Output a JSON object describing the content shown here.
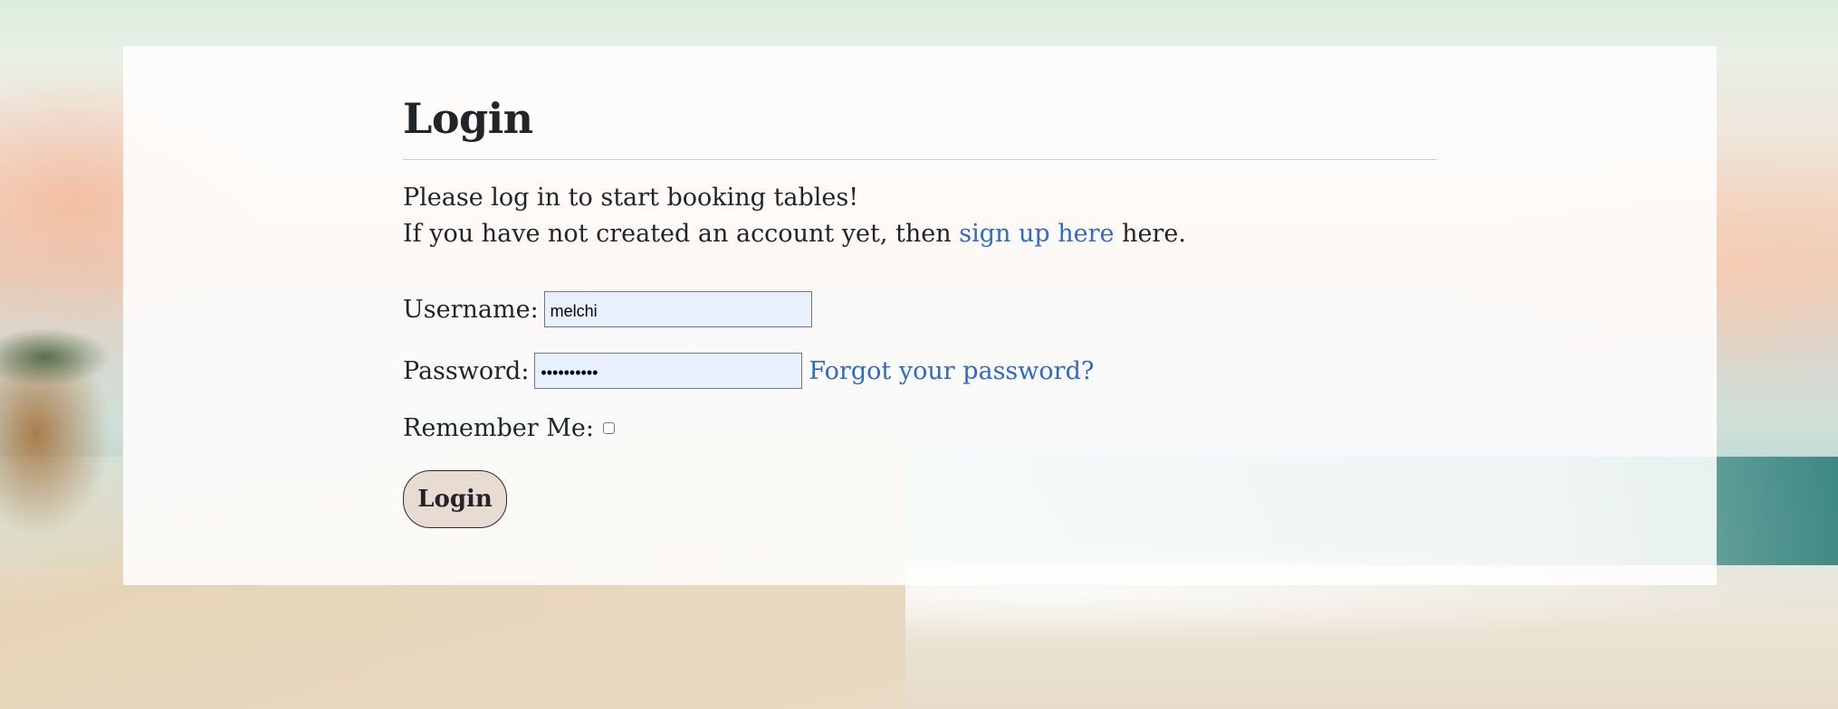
{
  "page": {
    "title": "Login",
    "intro_line1": "Please log in to start booking tables!",
    "intro_line2_prefix": "If you have not created an account yet, then ",
    "signup_link": "sign up here",
    "intro_line2_suffix": " here."
  },
  "form": {
    "username_label": "Username:",
    "username_value": "melchi",
    "password_label": "Password:",
    "password_value": "••••••••••",
    "forgot_link": "Forgot your password?",
    "remember_label": "Remember Me:",
    "remember_checked": false,
    "submit_label": "Login"
  },
  "colors": {
    "link": "#2c69d8",
    "autofill_bg": "#e8f0fe",
    "button_bg": "#e8dcd2"
  }
}
